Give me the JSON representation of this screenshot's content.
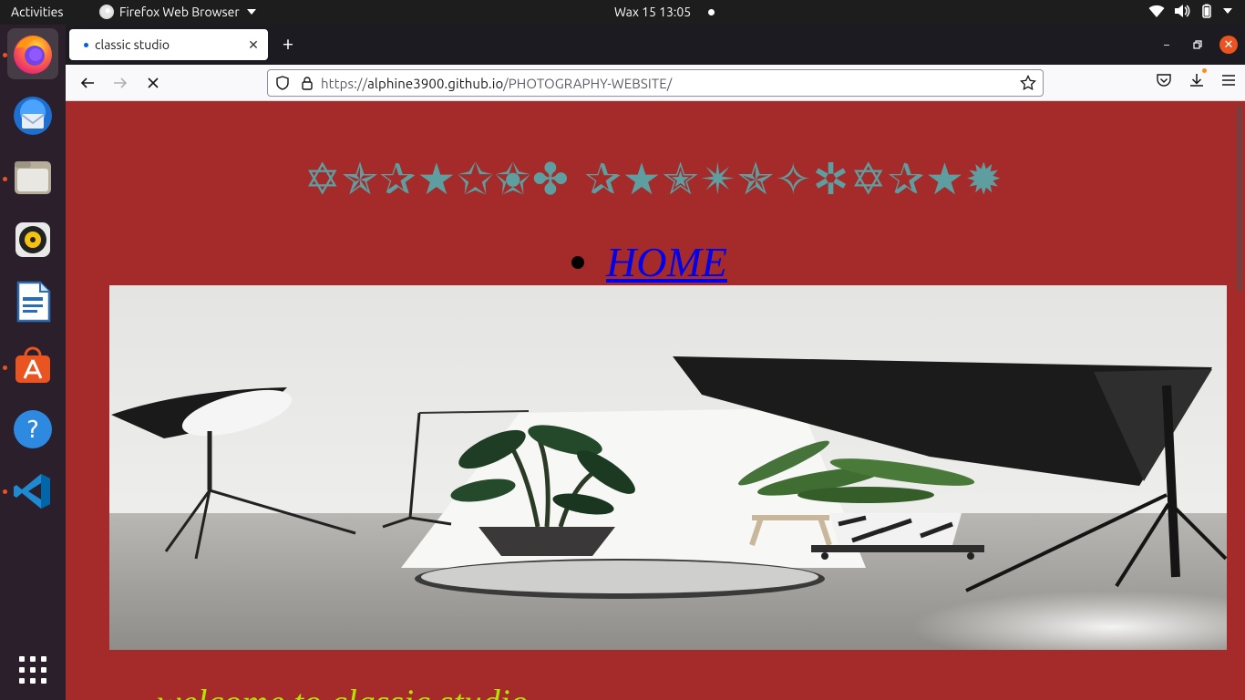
{
  "topbar": {
    "activities": "Activities",
    "app_name": "Firefox Web Browser",
    "clock": "Wax 15  13:05"
  },
  "dock": {
    "items": [
      {
        "icon": "firefox-icon",
        "active": true,
        "running": true
      },
      {
        "icon": "thunderbird-icon",
        "running": false
      },
      {
        "icon": "files-icon",
        "running": true
      },
      {
        "icon": "rhythmbox-icon",
        "running": false
      },
      {
        "icon": "libreoffice-writer-icon",
        "running": false
      },
      {
        "icon": "software-center-icon",
        "running": true
      },
      {
        "icon": "help-icon",
        "running": false
      },
      {
        "icon": "vscode-icon",
        "running": true
      }
    ],
    "apps_grid_icon": "show-applications-icon"
  },
  "browser": {
    "tab_title": "classic studio",
    "url_scheme": "https://",
    "url_host": "alphine3900.github.io",
    "url_path": "/PHOTOGRAPHY-WEBSITE/"
  },
  "page": {
    "title": "✡✯✰★✩✬✤ ✰★✭✴✯✧✲✡✰★✹",
    "nav": [
      {
        "label": "HOME"
      }
    ],
    "tagline": "welcome to classic studio"
  },
  "colors": {
    "page_bg": "#a52a2a",
    "title": "#5f9ea0",
    "link": "#0000ee",
    "tagline": "#b4e300",
    "accent": "#e95420"
  }
}
